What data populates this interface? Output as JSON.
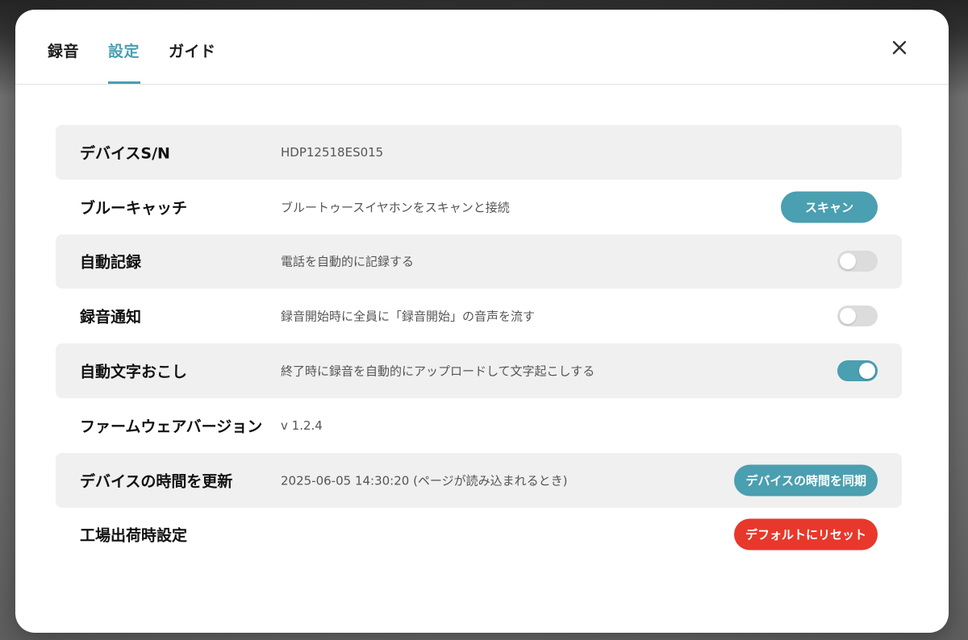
{
  "tabs": [
    {
      "label": "録音"
    },
    {
      "label": "設定"
    },
    {
      "label": "ガイド"
    }
  ],
  "active_tab": "設定",
  "colors": {
    "accent": "#4a9fb0",
    "danger": "#e8382c",
    "row_shade": "#f0f0f0"
  },
  "rows": {
    "serial": {
      "label": "デバイスS/N",
      "value": "HDP12518ES015"
    },
    "bluecatch": {
      "label": "ブルーキャッチ",
      "desc": "ブルートゥースイヤホンをスキャンと接続",
      "button": "スキャン"
    },
    "auto_record": {
      "label": "自動記録",
      "desc": "電話を自動的に記録する",
      "enabled": false
    },
    "record_notify": {
      "label": "録音通知",
      "desc": "録音開始時に全員に「録音開始」の音声を流す",
      "enabled": false
    },
    "auto_transcribe": {
      "label": "自動文字おこし",
      "desc": "終了時に録音を自動的にアップロードして文字起こしする",
      "enabled": true
    },
    "firmware": {
      "label": "ファームウェアバージョン",
      "value": "v 1.2.4"
    },
    "device_time": {
      "label": "デバイスの時間を更新",
      "desc": "2025-06-05 14:30:20 (ページが読み込まれるとき)",
      "button": "デバイスの時間を同期"
    },
    "factory_reset": {
      "label": "工場出荷時設定",
      "button": "デフォルトにリセット"
    }
  },
  "icons": {
    "close": "close-icon"
  }
}
